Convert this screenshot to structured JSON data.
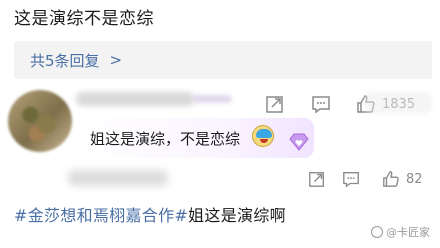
{
  "post": {
    "text": "这是演综不是恋综"
  },
  "replies": {
    "label": "共5条回复",
    "chevron": ">"
  },
  "comment1": {
    "text": "姐这是演综，不是恋综",
    "like_count": "1835",
    "emoji_icon": "doraemon-face-icon",
    "badge_icon": "diamond-heart-icon"
  },
  "comment2": {
    "like_count": "82"
  },
  "footer": {
    "hashtag1": "#金莎想和焉栩嘉合作#",
    "hashtag2": "姐这是演综啊"
  },
  "watermark": {
    "text": "@卡匠家"
  },
  "colors": {
    "link": "#4a6fa5",
    "icon": "#8a8a8a",
    "bar": "#f3f3f3"
  }
}
